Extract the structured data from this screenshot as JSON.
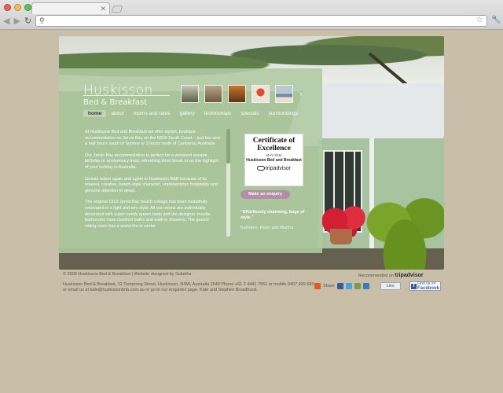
{
  "browser": {
    "address_value": "",
    "address_placeholder": ""
  },
  "site": {
    "logo_title": "Huskisson",
    "logo_subtitle": "Bed & Breakfast",
    "nav": [
      "home",
      "about",
      "rooms and rates",
      "gallery",
      "testimonials",
      "specials",
      "surroundings"
    ],
    "active_nav": "home",
    "paragraphs": [
      "At Huskisson Bed and Breakfast we offer stylish, boutique accommodation on Jervis Bay on the NSW South Coast – just two and a half hours south of Sydney or 3 hours north of Canberra, Australia.",
      "Our Jervis Bay accommodation is perfect for a weekend escape, birthday or anniversary treat, refreshing short break or as the highlight of your holiday in Australia.",
      "Guests return again and again to Huskisson B&B because of its relaxed, creative, beach-style character, unpretentious hospitality and genuine attention to detail.",
      "The original 1913 Jervis Bay beach cottage has been beautifully renovated in a light and airy style. All our rooms are individually decorated with super-comfy queen beds and the designer ensuite bathrooms have clawfoot baths and walk-in showers. The guests' sitting-room has a wood-fire in winter"
    ],
    "certificate": {
      "title": "Certificate of Excellence",
      "date": "MAY 2011",
      "name": "Huskisson Bed and Breakfast",
      "logo": "tripadvisor"
    },
    "enquiry_button": "Make an enquiry",
    "quote": "\"Effortlessly charming, bags of style.\"",
    "quote_by": "Kathleen, Peter and Martha"
  },
  "footer": {
    "copyright": "© 2009 Huskisson Bed & Breakfast  |  Website designed by Subetha",
    "address": "Huskisson Bed & Breakfast, 12 Tomerong Street, Huskisson, NSW, Australia 2540 Phone +61 2 4441 7551 or mobile 0407 929 583 or email us at kate@huskissonbnb.com.au or go to our enquiries page. Kate and Stephen Broadhurst.",
    "recommended_on": "Recommended on",
    "tripadvisor": "tripadvisor",
    "share_label": "Share",
    "like_label": "Like",
    "facebook_find": "Find us on",
    "facebook_word": "Facebook"
  },
  "colors": {
    "background": "#c9bfa9",
    "panel": "#b0c9a3",
    "enquiry_button": "#b58da7",
    "facebook": "#3b5998"
  }
}
